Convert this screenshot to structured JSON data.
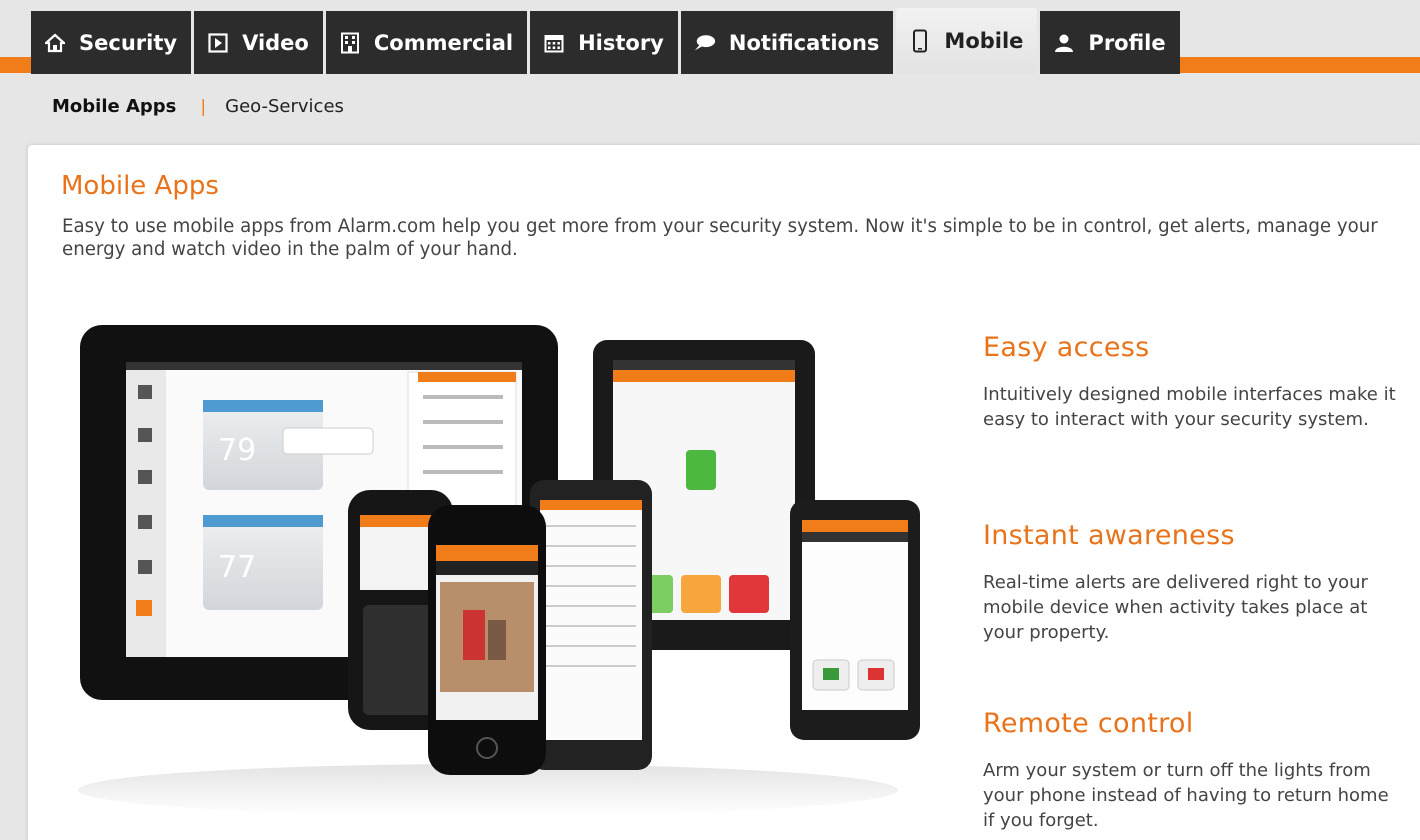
{
  "tabs": [
    {
      "label": "Security",
      "icon": "home-icon",
      "active": false
    },
    {
      "label": "Video",
      "icon": "play-icon",
      "active": false
    },
    {
      "label": "Commercial",
      "icon": "building-icon",
      "active": false
    },
    {
      "label": "History",
      "icon": "calendar-icon",
      "active": false
    },
    {
      "label": "Notifications",
      "icon": "chat-bubble-icon",
      "active": false
    },
    {
      "label": "Mobile",
      "icon": "mobile-icon",
      "active": true
    },
    {
      "label": "Profile",
      "icon": "user-icon",
      "active": false
    }
  ],
  "subnav": {
    "current": "Mobile Apps",
    "link": "Geo-Services"
  },
  "main": {
    "title": "Mobile Apps",
    "intro": "Easy to use mobile apps from Alarm.com help you get more from your security system. Now it's simple to be in control, get alerts, manage your energy and watch video in the palm of your hand."
  },
  "features": [
    {
      "title": "Easy access",
      "text": "Intuitively designed mobile interfaces make it easy to interact with your security system."
    },
    {
      "title": "Instant awareness",
      "text": "Real-time alerts are delivered right to your mobile device when activity takes place at your property."
    },
    {
      "title": "Remote control",
      "text": "Arm your system or turn off the lights from your phone instead of having to return home if you forget."
    }
  ],
  "colors": {
    "accent": "#f07d1a",
    "tab_bg": "#2c2c2c",
    "heading": "#e8731a"
  }
}
